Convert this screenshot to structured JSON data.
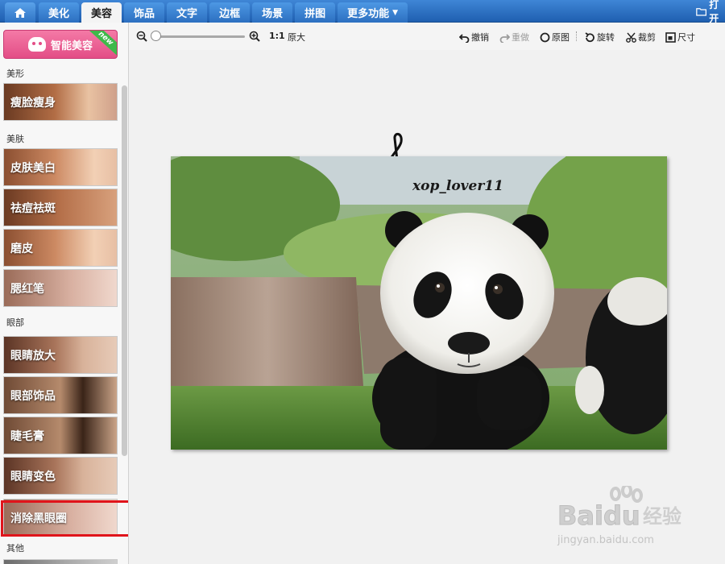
{
  "app": {
    "tabs": [
      {
        "label": "美化"
      },
      {
        "label": "美容"
      },
      {
        "label": "饰品"
      },
      {
        "label": "文字"
      },
      {
        "label": "边框"
      },
      {
        "label": "场景"
      },
      {
        "label": "拼图"
      },
      {
        "label": "更多功能"
      }
    ],
    "active_tab": "美容",
    "open_label": "打开"
  },
  "sidebar": {
    "smart_button": {
      "label": "智能美容",
      "badge": "new"
    },
    "sections": [
      {
        "title": "美形",
        "items": [
          {
            "label": "瘦脸瘦身"
          }
        ]
      },
      {
        "title": "美肤",
        "items": [
          {
            "label": "皮肤美白"
          },
          {
            "label": "祛痘祛斑"
          },
          {
            "label": "磨皮"
          },
          {
            "label": "腮红笔"
          }
        ]
      },
      {
        "title": "眼部",
        "items": [
          {
            "label": "眼睛放大"
          },
          {
            "label": "眼部饰品"
          },
          {
            "label": "睫毛膏"
          },
          {
            "label": "眼睛变色"
          },
          {
            "label": "消除黑眼圈"
          }
        ]
      },
      {
        "title": "其他",
        "items": []
      }
    ],
    "highlighted_item": "消除黑眼圈",
    "highlight_color": "#e0141b"
  },
  "toolbar": {
    "zoom_ratio": "1:1",
    "original_size_label": "原大",
    "undo_label": "撤销",
    "redo_label": "重做",
    "original_label": "原图",
    "rotate_label": "旋转",
    "crop_label": "裁剪",
    "size_label": "尺寸",
    "zoom_level": 0
  },
  "canvas": {
    "photo_subject": "panda",
    "photo_watermark_text": "xop_lover11"
  },
  "site_watermark": {
    "text": "Baidu",
    "chinese": "经验",
    "url": "jingyan.baidu.com"
  },
  "colors": {
    "topbar": "#2c6fc0",
    "accent_pink": "#e34d86",
    "new_badge": "#3fb94a"
  }
}
